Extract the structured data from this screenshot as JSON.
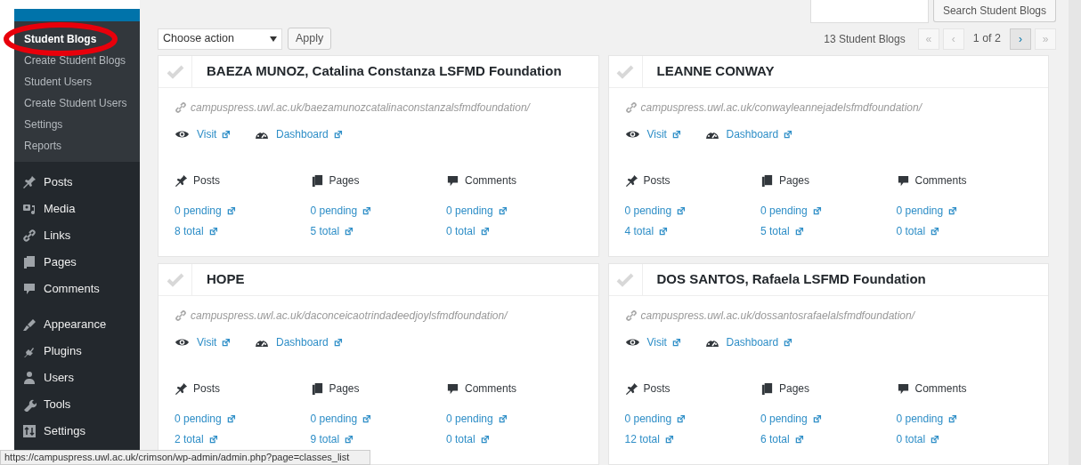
{
  "sidebar": {
    "submenu": [
      {
        "label": "Student Blogs",
        "selected": true
      },
      {
        "label": "Create Student Blogs",
        "selected": false
      },
      {
        "label": "Student Users",
        "selected": false
      },
      {
        "label": "Create Student Users",
        "selected": false
      },
      {
        "label": "Settings",
        "selected": false
      },
      {
        "label": "Reports",
        "selected": false
      }
    ],
    "menu": [
      {
        "label": "Posts"
      },
      {
        "label": "Media"
      },
      {
        "label": "Links"
      },
      {
        "label": "Pages"
      },
      {
        "label": "Comments"
      },
      {
        "label": "Appearance"
      },
      {
        "label": "Plugins"
      },
      {
        "label": "Users"
      },
      {
        "label": "Tools"
      },
      {
        "label": "Settings"
      }
    ]
  },
  "search": {
    "button": "Search Student Blogs"
  },
  "bulk": {
    "select": "Choose action",
    "apply": "Apply"
  },
  "pagination": {
    "count": "13 Student Blogs",
    "page": "1 of 2",
    "buttons": [
      {
        "label": "«",
        "disabled": true
      },
      {
        "label": "‹",
        "disabled": true
      },
      {
        "label": "›",
        "disabled": false
      },
      {
        "label": "»",
        "disabled": true
      }
    ]
  },
  "cards": [
    {
      "title": "BAEZA MUNOZ, Catalina Constanza LSFMD Foundation",
      "url": "campuspress.uwl.ac.uk/baezamunozcatalinaconstanzalsfmdfoundation/",
      "visit": "Visit",
      "dashboard": "Dashboard",
      "stats": [
        {
          "label": "Posts",
          "pending": "0 pending",
          "total": "8 total"
        },
        {
          "label": "Pages",
          "pending": "0 pending",
          "total": "5 total"
        },
        {
          "label": "Comments",
          "pending": "0 pending",
          "total": "0 total"
        }
      ]
    },
    {
      "title": "LEANNE CONWAY",
      "url": "campuspress.uwl.ac.uk/conwayleannejadelsfmdfoundation/",
      "visit": "Visit",
      "dashboard": "Dashboard",
      "stats": [
        {
          "label": "Posts",
          "pending": "0 pending",
          "total": "4 total"
        },
        {
          "label": "Pages",
          "pending": "0 pending",
          "total": "5 total"
        },
        {
          "label": "Comments",
          "pending": "0 pending",
          "total": "0 total"
        }
      ]
    },
    {
      "title": "HOPE",
      "url": "campuspress.uwl.ac.uk/daconceicaotrindadeedjoylsfmdfoundation/",
      "visit": "Visit",
      "dashboard": "Dashboard",
      "stats": [
        {
          "label": "Posts",
          "pending": "0 pending",
          "total": "2 total"
        },
        {
          "label": "Pages",
          "pending": "0 pending",
          "total": "9 total"
        },
        {
          "label": "Comments",
          "pending": "0 pending",
          "total": "0 total"
        }
      ]
    },
    {
      "title": "DOS SANTOS, Rafaela LSFMD Foundation",
      "url": "campuspress.uwl.ac.uk/dossantosrafaelalsfmdfoundation/",
      "visit": "Visit",
      "dashboard": "Dashboard",
      "stats": [
        {
          "label": "Posts",
          "pending": "0 pending",
          "total": "12 total"
        },
        {
          "label": "Pages",
          "pending": "0 pending",
          "total": "6 total"
        },
        {
          "label": "Comments",
          "pending": "0 pending",
          "total": "0 total"
        }
      ]
    }
  ],
  "status_bar": {
    "url": "https://campuspress.uwl.ac.uk/crimson/wp-admin/admin.php?page=classes_list"
  }
}
